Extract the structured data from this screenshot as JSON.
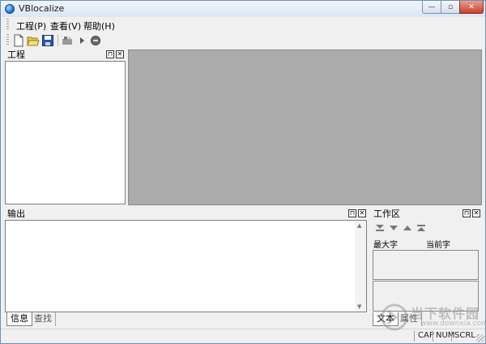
{
  "window": {
    "title": "VBlocalize"
  },
  "caption_buttons": {
    "minimize": "—",
    "maximize": "▫",
    "close": "✕"
  },
  "menu": {
    "items": [
      {
        "label": "工程(P)"
      },
      {
        "label": "查看(V)"
      },
      {
        "label": "帮助(H)"
      }
    ]
  },
  "toolbar": {
    "icons": [
      "new-file-icon",
      "open-folder-icon",
      "save-icon",
      "build-icon",
      "run-icon",
      "stop-icon"
    ]
  },
  "panes": {
    "project": {
      "title": "工程"
    },
    "output": {
      "title": "输出"
    },
    "workspace": {
      "title": "工作区"
    },
    "pin_glyph": "⊓",
    "close_glyph": "✕"
  },
  "workspace": {
    "columns": [
      "最大字",
      "当前字"
    ]
  },
  "output_tabs": [
    {
      "label": "信息",
      "active": true
    },
    {
      "label": "查找",
      "active": false
    }
  ],
  "workspace_tabs": [
    {
      "label": "文本",
      "active": true
    },
    {
      "label": "属性",
      "active": false
    }
  ],
  "statusbar": {
    "cap": "CAP",
    "num": "NUM",
    "scrl": "SCRL"
  },
  "watermark": {
    "line1": "当下软件园",
    "line2": "www.downxia.com"
  },
  "colors": {
    "mdi_background": "#ababab",
    "window_border": "#6d8db5"
  }
}
